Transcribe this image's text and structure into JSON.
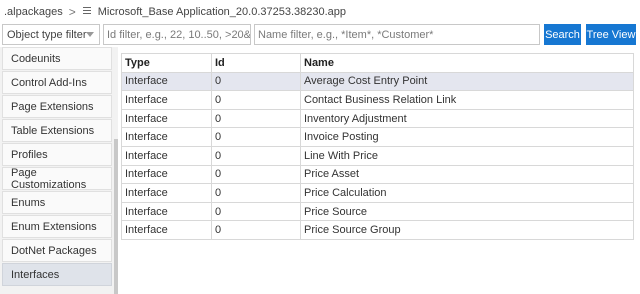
{
  "breadcrumb": {
    "root": ".alpackages",
    "separator": ">",
    "file": "Microsoft_Base Application_20.0.37253.38230.app"
  },
  "filters": {
    "type_filter_label": "Object type filter",
    "id_placeholder": "Id filter, e.g., 22, 10..50, >20&<30",
    "name_placeholder": "Name filter, e.g., *Item*, *Customer*",
    "search_label": "Search",
    "tree_view_label": "Tree View"
  },
  "sidebar": {
    "items": [
      {
        "label": "Codeunits"
      },
      {
        "label": "Control Add-Ins"
      },
      {
        "label": "Page Extensions"
      },
      {
        "label": "Table Extensions"
      },
      {
        "label": "Profiles"
      },
      {
        "label": "Page Customizations"
      },
      {
        "label": "Enums"
      },
      {
        "label": "Enum Extensions"
      },
      {
        "label": "DotNet Packages"
      },
      {
        "label": "Interfaces"
      }
    ],
    "active_index": 9
  },
  "table": {
    "headers": {
      "type": "Type",
      "id": "Id",
      "name": "Name"
    },
    "rows": [
      {
        "type": "Interface",
        "id": "0",
        "name": "Average Cost Entry Point"
      },
      {
        "type": "Interface",
        "id": "0",
        "name": "Contact Business Relation Link"
      },
      {
        "type": "Interface",
        "id": "0",
        "name": "Inventory Adjustment"
      },
      {
        "type": "Interface",
        "id": "0",
        "name": "Invoice Posting"
      },
      {
        "type": "Interface",
        "id": "0",
        "name": "Line With Price"
      },
      {
        "type": "Interface",
        "id": "0",
        "name": "Price Asset"
      },
      {
        "type": "Interface",
        "id": "0",
        "name": "Price Calculation"
      },
      {
        "type": "Interface",
        "id": "0",
        "name": "Price Source"
      },
      {
        "type": "Interface",
        "id": "0",
        "name": "Price Source Group"
      }
    ],
    "selected_index": 0
  },
  "colors": {
    "accent": "#1677d2",
    "selected_row": "#e4e6ef",
    "active_sidebar": "#dfe3ea"
  }
}
